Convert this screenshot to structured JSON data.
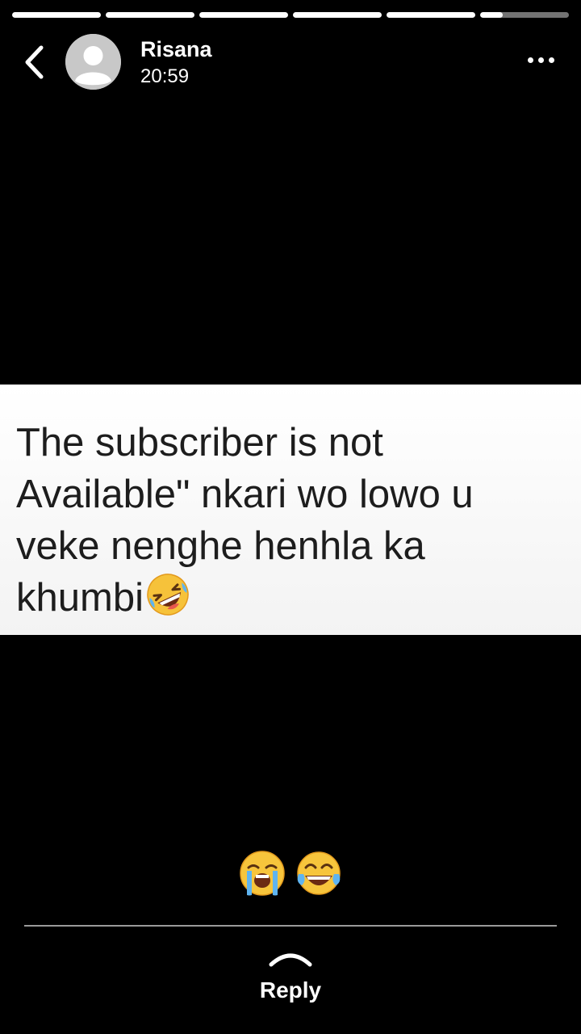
{
  "progress": [
    1,
    1,
    1,
    1,
    1,
    0.25
  ],
  "header": {
    "name": "Risana",
    "time": "20:59"
  },
  "status": {
    "line1": "The subscriber is not",
    "line2": "Available\" nkari wo lowo u",
    "line3": "veke nenghe henhla ka",
    "line4": "khumbi",
    "emoji": "rolling-on-the-floor-laughing"
  },
  "reactions": [
    "loudly-crying-face",
    "face-with-tears-of-joy"
  ],
  "reply": {
    "label": "Reply"
  }
}
